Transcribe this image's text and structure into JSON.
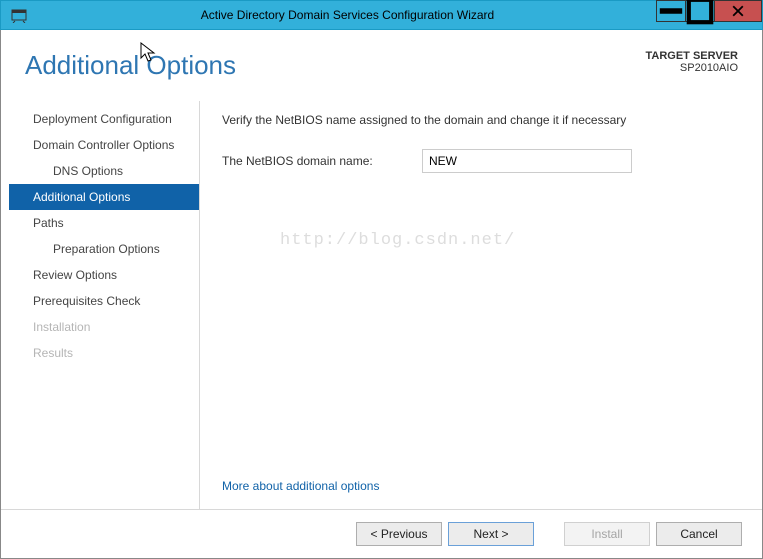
{
  "window": {
    "title": "Active Directory Domain Services Configuration Wizard"
  },
  "header": {
    "title": "Additional Options",
    "target_label": "TARGET SERVER",
    "target_value": "SP2010AIO"
  },
  "sidebar": {
    "items": [
      {
        "label": "Deployment Configuration",
        "level": "top"
      },
      {
        "label": "Domain Controller Options",
        "level": "top"
      },
      {
        "label": "DNS Options",
        "level": "sub"
      },
      {
        "label": "Additional Options",
        "level": "top",
        "active": true
      },
      {
        "label": "Paths",
        "level": "top"
      },
      {
        "label": "Preparation Options",
        "level": "sub"
      },
      {
        "label": "Review Options",
        "level": "top"
      },
      {
        "label": "Prerequisites Check",
        "level": "top"
      },
      {
        "label": "Installation",
        "level": "top",
        "disabled": true
      },
      {
        "label": "Results",
        "level": "top",
        "disabled": true
      }
    ]
  },
  "content": {
    "instruction": "Verify the NetBIOS name assigned to the domain and change it if necessary",
    "netbios_label": "The NetBIOS domain name:",
    "netbios_value": "NEW",
    "more_link": "More about additional options",
    "watermark": "http://blog.csdn.net/"
  },
  "footer": {
    "previous": "< Previous",
    "next": "Next >",
    "install": "Install",
    "cancel": "Cancel"
  }
}
